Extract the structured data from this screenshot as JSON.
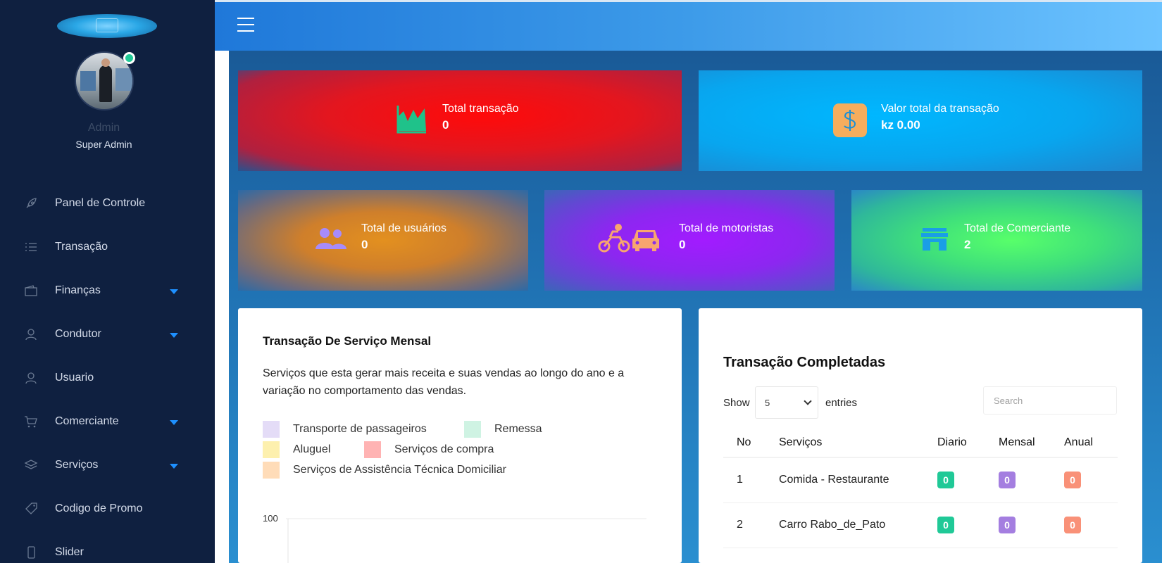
{
  "sidebar": {
    "admin_name": "Admin",
    "admin_role": "Super Admin",
    "items": [
      {
        "label": "Panel de Controle",
        "icon": "rocket-icon",
        "has_caret": false
      },
      {
        "label": "Transação",
        "icon": "list-icon",
        "has_caret": false
      },
      {
        "label": "Finanças",
        "icon": "wallet-icon",
        "has_caret": true
      },
      {
        "label": "Condutor",
        "icon": "user-icon",
        "has_caret": true
      },
      {
        "label": "Usuario",
        "icon": "user-icon",
        "has_caret": false
      },
      {
        "label": "Comerciante",
        "icon": "cart-icon",
        "has_caret": true
      },
      {
        "label": "Serviços",
        "icon": "layers-icon",
        "has_caret": true
      },
      {
        "label": "Codigo de Promo",
        "icon": "tag-icon",
        "has_caret": false
      },
      {
        "label": "Slider",
        "icon": "mobile-icon",
        "has_caret": false
      }
    ]
  },
  "stats": {
    "total_transacao": {
      "label": "Total transação",
      "value": "0"
    },
    "valor_total": {
      "label": "Valor total da transação",
      "value": "kz 0.00"
    },
    "total_usuarios": {
      "label": "Total de usuários",
      "value": "0"
    },
    "total_motoristas": {
      "label": "Total de motoristas",
      "value": "0"
    },
    "total_comerciante": {
      "label": "Total de Comerciante",
      "value": "2"
    }
  },
  "chart_panel": {
    "title": "Transação De Serviço Mensal",
    "description": "Serviços que esta gerar mais receita e suas vendas ao longo do ano e a variação no comportamento das vendas.",
    "legend": [
      {
        "label": "Transporte de passageiros",
        "color": "#e4dcf7"
      },
      {
        "label": "Remessa",
        "color": "#cff3e3"
      },
      {
        "label": "Aluguel",
        "color": "#fdf0ae"
      },
      {
        "label": "Serviços de compra",
        "color": "#ffb3b3"
      },
      {
        "label": "Serviços de Assistência Técnica Domiciliar",
        "color": "#ffdcb8"
      }
    ],
    "y_tick_top": "100"
  },
  "chart_data": {
    "type": "line",
    "title": "Transação De Serviço Mensal",
    "series": [
      {
        "name": "Transporte de passageiros",
        "values": []
      },
      {
        "name": "Remessa",
        "values": []
      },
      {
        "name": "Aluguel",
        "values": []
      },
      {
        "name": "Serviços de compra",
        "values": []
      },
      {
        "name": "Serviços de Assistência Técnica Domiciliar",
        "values": []
      }
    ],
    "y_ticks_visible": [
      100
    ]
  },
  "table_panel": {
    "title": "Transação Completadas",
    "show_label": "Show",
    "entries_label": "entries",
    "page_size": "5",
    "search_placeholder": "Search",
    "columns": [
      "No",
      "Serviços",
      "Diario",
      "Mensal",
      "Anual"
    ],
    "rows": [
      {
        "no": "1",
        "servico": "Comida - Restaurante",
        "diario": "0",
        "mensal": "0",
        "anual": "0"
      },
      {
        "no": "2",
        "servico": "Carro Rabo_de_Pato",
        "diario": "0",
        "mensal": "0",
        "anual": "0"
      }
    ],
    "badge_colors": {
      "diario": "#20c997",
      "mensal": "#a47ee0",
      "anual": "#f99178"
    }
  }
}
